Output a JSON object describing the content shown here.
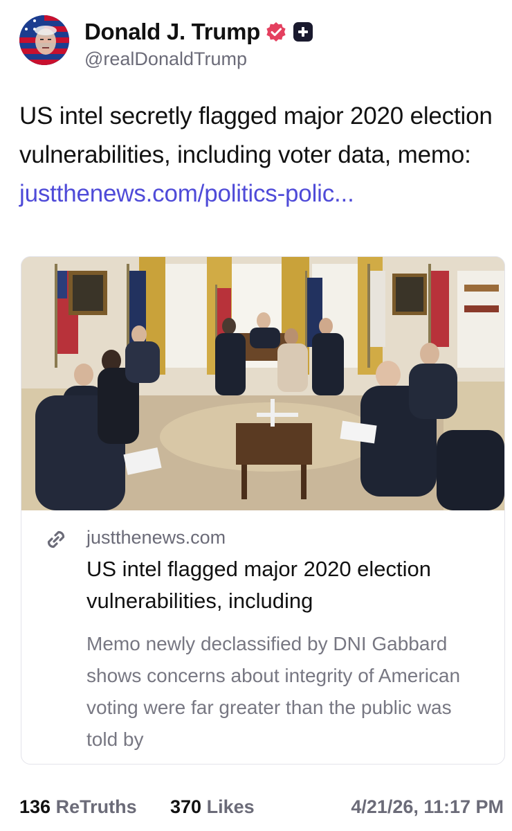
{
  "author": {
    "display_name": "Donald J. Trump",
    "handle": "@realDonaldTrump",
    "verified_icon": "verified-badge-icon",
    "plus_icon": "plus-badge-icon"
  },
  "post": {
    "text": "US intel secretly flagged major 2020 election vulnerabilities, including voter data, memo: ",
    "link_text": "justthenews.com/politics-polic..."
  },
  "card": {
    "domain": "justthenews.com",
    "title": "US intel flagged major 2020 election vulnerabilities, including",
    "description": "Memo newly declassified by DNI Gabbard shows concerns about integrity of American voting were far greater than the public was told by",
    "icon": "link-icon"
  },
  "stats": {
    "retruths_count": "136",
    "retruths_label": "ReTruths",
    "likes_count": "370",
    "likes_label": "Likes",
    "timestamp": "4/21/26, 11:17 PM"
  },
  "colors": {
    "link": "#4f4bd8",
    "verified": "#e4405f",
    "muted": "#6b6b78"
  }
}
